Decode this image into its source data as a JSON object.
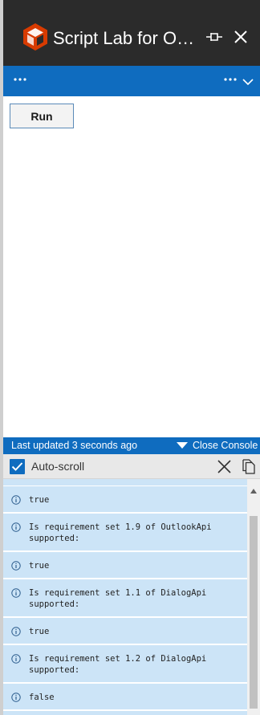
{
  "window": {
    "title": "Script Lab for Outlook",
    "colors": {
      "titlebar": "#2b2b2b",
      "accent": "#0f6cbf",
      "logo": "#d83b01"
    }
  },
  "command_bar": {
    "left_menu_icon": "ellipsis-icon",
    "right_menu_icon": "ellipsis-icon",
    "dropdown_icon": "chevron-down-icon"
  },
  "main": {
    "run_label": "Run"
  },
  "console": {
    "status_text": "Last updated 3 seconds ago",
    "close_label": "Close Console",
    "autoscroll_label": "Auto-scroll",
    "autoscroll_checked": true,
    "entries": [
      {
        "level": "info",
        "text": "true"
      },
      {
        "level": "info",
        "text": "Is requirement set 1.9 of OutlookApi\nsupported:"
      },
      {
        "level": "info",
        "text": "true"
      },
      {
        "level": "info",
        "text": "Is requirement set 1.1 of DialogApi\nsupported:"
      },
      {
        "level": "info",
        "text": "true"
      },
      {
        "level": "info",
        "text": "Is requirement set 1.2 of DialogApi\nsupported:"
      },
      {
        "level": "info",
        "text": "false"
      }
    ]
  }
}
